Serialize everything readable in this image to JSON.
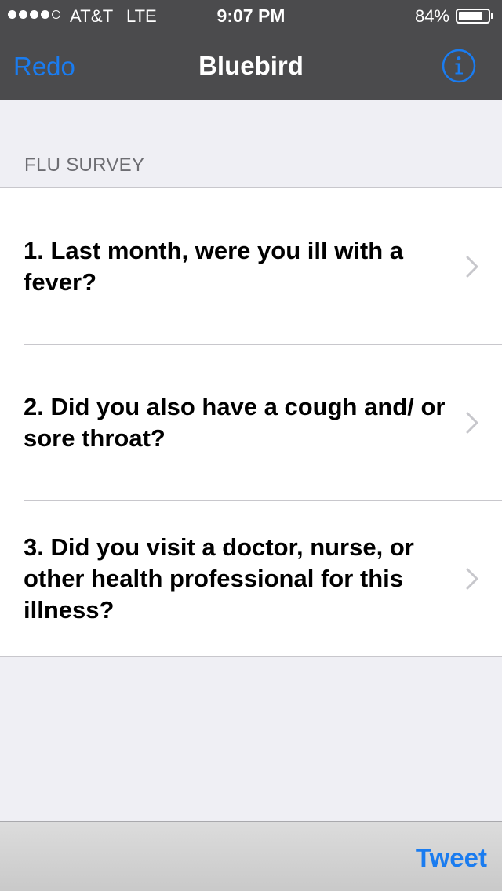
{
  "status_bar": {
    "carrier": "AT&T",
    "network": "LTE",
    "time": "9:07 PM",
    "battery_percent": "84%",
    "battery_level": 0.84,
    "signal_bars_filled": 4,
    "signal_bars_total": 5
  },
  "nav": {
    "left_button": "Redo",
    "title": "Bluebird",
    "right_icon": "info-icon"
  },
  "section": {
    "header": "FLU SURVEY"
  },
  "questions": [
    {
      "text": "1. Last month, were you ill with a fever?"
    },
    {
      "text": "2. Did you also have a cough and/ or sore throat?"
    },
    {
      "text": "3. Did you visit a doctor, nurse, or other health professional for this illness?"
    }
  ],
  "toolbar": {
    "tweet_label": "Tweet"
  },
  "colors": {
    "accent": "#1a7cf0",
    "bar_background": "#4b4b4d",
    "page_background": "#efeff4"
  }
}
